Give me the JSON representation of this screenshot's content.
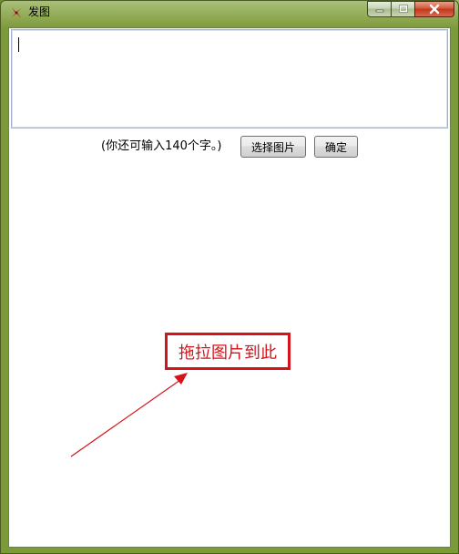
{
  "window": {
    "title": "发图",
    "icon": "red-pinwheel-icon"
  },
  "caption_buttons": [
    "minimize-icon",
    "maximize-icon",
    "close-icon"
  ],
  "compose": {
    "text_value": "",
    "remaining_text": "(你还可输入140个字。)"
  },
  "buttons": {
    "select_image": "选择图片",
    "confirm": "确定"
  },
  "drop_area": {
    "hint": "拖拉图片到此"
  },
  "colors": {
    "hint_red": "#d4131b",
    "title_bar_green": "#8aa44a"
  }
}
